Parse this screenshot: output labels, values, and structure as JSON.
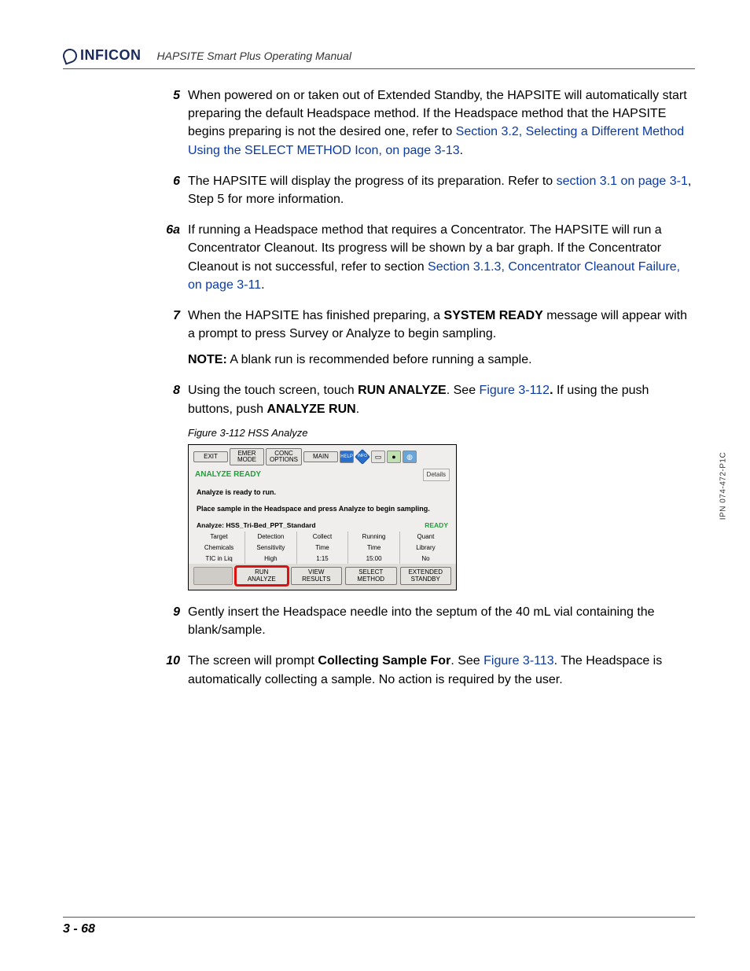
{
  "header": {
    "brand": "INFICON",
    "manual_title": "HAPSITE Smart Plus Operating Manual"
  },
  "steps": {
    "s5": {
      "num": "5",
      "t1": "When powered on or taken out of Extended Standby, the HAPSITE will automatically start preparing the default Headspace method. If the Headspace method that the HAPSITE begins preparing is not the desired one, refer to ",
      "link1": "Section 3.2, Selecting a Different Method Using the SELECT METHOD Icon, on page 3-13",
      "t2": "."
    },
    "s6": {
      "num": "6",
      "t1": "The HAPSITE will display the progress of its preparation. Refer to ",
      "link1": "section 3.1 on page 3-1",
      "t2": ", Step 5 for more information."
    },
    "s6a": {
      "num": "6a",
      "t1": "If running a Headspace method that requires a Concentrator. The HAPSITE will run a Concentrator Cleanout. Its progress will be shown by a bar graph. If the Concentrator Cleanout is not successful, refer to section ",
      "link1": "Section 3.1.3, Concentrator Cleanout Failure, on page 3-11",
      "t2": "."
    },
    "s7": {
      "num": "7",
      "t1": "When the HAPSITE has finished preparing, a ",
      "b1": "SYSTEM READY",
      "t2": " message will appear with a prompt to press Survey or Analyze to begin sampling.",
      "note_label": "NOTE:",
      "note_text": "  A blank run is recommended before running a sample."
    },
    "s8": {
      "num": "8",
      "t1": "Using the touch screen, touch ",
      "b1": "RUN ANALYZE",
      "t2": ". See ",
      "link1": "Figure 3-112",
      "t3": " If using the push buttons, push ",
      "b2": "ANALYZE RUN",
      "t4": "."
    },
    "fig_caption": "Figure 3-112  HSS Analyze",
    "s9": {
      "num": "9",
      "t1": "Gently insert the Headspace needle into the septum of the 40 mL vial containing the blank/sample."
    },
    "s10": {
      "num": "10",
      "t1": "The screen will prompt ",
      "b1": "Collecting Sample For",
      "t2": ". See ",
      "link1": "Figure 3-113",
      "t3": ". The Headspace is automatically collecting a sample. No action is required by the user."
    }
  },
  "screenshot": {
    "toolbar": {
      "exit": "EXIT",
      "emer": "EMER\nMODE",
      "conc": "CONC\nOPTIONS",
      "main": "MAIN",
      "help": "HELP",
      "info": "INFO"
    },
    "status_title": "ANALYZE READY",
    "details": "Details",
    "body_l1": "Analyze is ready to run.",
    "body_l2": "Place sample in the Headspace and press Analyze to begin sampling.",
    "midline": "Analyze: HSS_Tri-Bed_PPT_Standard",
    "ready": "READY",
    "table": {
      "h1": "Target",
      "h2": "Detection",
      "h3": "Collect",
      "h4": "Running",
      "h5": "Quant",
      "r2c1": "Chemicals",
      "r2c2": "Sensitivity",
      "r2c3": "Time",
      "r2c4": "Time",
      "r2c5": "Library",
      "r3c1": "TIC in Liq",
      "r3c2": "High",
      "r3c3": "1:15",
      "r3c4": "15:00",
      "r3c5": "No"
    },
    "bottom": {
      "run": "RUN\nANALYZE",
      "view": "VIEW\nRESULTS",
      "select": "SELECT\nMETHOD",
      "standby": "EXTENDED\nSTANDBY"
    }
  },
  "footer": {
    "page_num": "3 - 68",
    "side_code": "IPN 074-472-P1C"
  }
}
